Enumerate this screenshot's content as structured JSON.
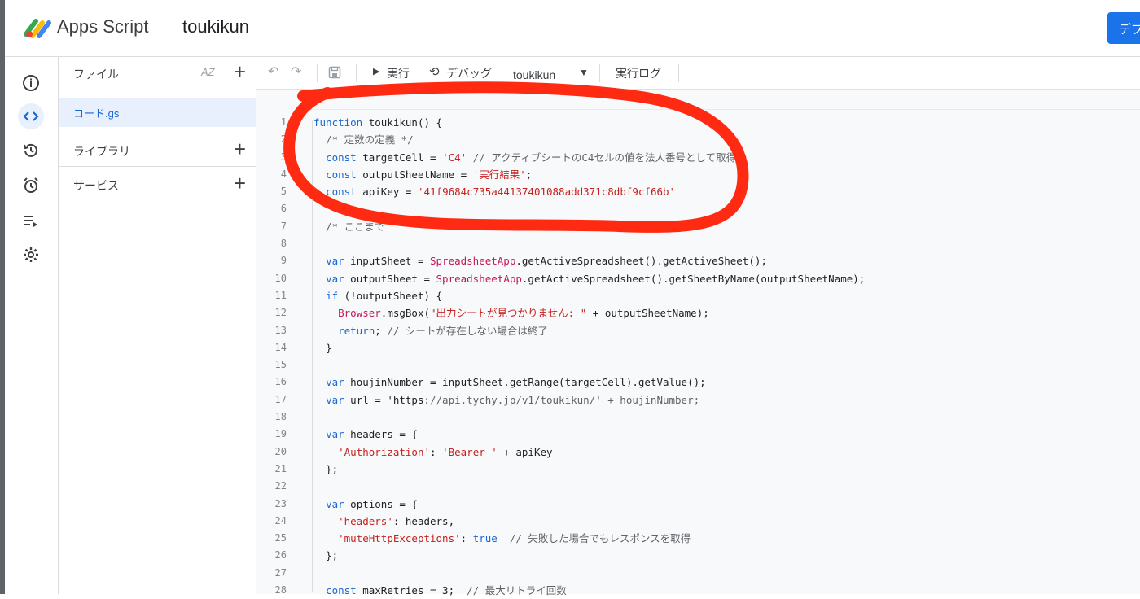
{
  "header": {
    "app_name": "Apps Script",
    "project_name": "toukikun",
    "deploy_label": "デプ"
  },
  "file_panel": {
    "files_label": "ファイル",
    "sort_label": "AZ",
    "selected_file": "コード.gs",
    "library_label": "ライブラリ",
    "services_label": "サービス"
  },
  "toolbar": {
    "run_label": "実行",
    "debug_label": "デバッグ",
    "function_select": "toukikun",
    "log_label": "実行ログ"
  },
  "code_lines": [
    {
      "n": "1",
      "html": "function toukikun() {"
    },
    {
      "n": "2",
      "html": "  /* 定数の定義 */"
    },
    {
      "n": "3",
      "html": "  const targetCell = 'C4' // アクティブシートのC4セルの値を法人番号として取得"
    },
    {
      "n": "4",
      "html": "  const outputSheetName = '実行結果';"
    },
    {
      "n": "5",
      "html": "  const apiKey = '41f9684c735a44137401088add371c8dbf9cf66b'"
    },
    {
      "n": "6",
      "html": ""
    },
    {
      "n": "7",
      "html": "  /* ここまで"
    },
    {
      "n": "8",
      "html": ""
    },
    {
      "n": "9",
      "html": "  var inputSheet = SpreadsheetApp.getActiveSpreadsheet().getActiveSheet();"
    },
    {
      "n": "10",
      "html": "  var outputSheet = SpreadsheetApp.getActiveSpreadsheet().getSheetByName(outputSheetName);"
    },
    {
      "n": "11",
      "html": "  if (!outputSheet) {"
    },
    {
      "n": "12",
      "html": "    Browser.msgBox(\"出力シートが見つかりません: \" + outputSheetName);"
    },
    {
      "n": "13",
      "html": "    return; // シートが存在しない場合は終了"
    },
    {
      "n": "14",
      "html": "  }"
    },
    {
      "n": "15",
      "html": ""
    },
    {
      "n": "16",
      "html": "  var houjinNumber = inputSheet.getRange(targetCell).getValue();"
    },
    {
      "n": "17",
      "html": "  var url = 'https://api.tychy.jp/v1/toukikun/' + houjinNumber;"
    },
    {
      "n": "18",
      "html": ""
    },
    {
      "n": "19",
      "html": "  var headers = {"
    },
    {
      "n": "20",
      "html": "    'Authorization': 'Bearer ' + apiKey"
    },
    {
      "n": "21",
      "html": "  };"
    },
    {
      "n": "22",
      "html": ""
    },
    {
      "n": "23",
      "html": "  var options = {"
    },
    {
      "n": "24",
      "html": "    'headers': headers,"
    },
    {
      "n": "25",
      "html": "    'muteHttpExceptions': true  // 失敗した場合でもレスポンスを取得"
    },
    {
      "n": "26",
      "html": "  };"
    },
    {
      "n": "27",
      "html": ""
    },
    {
      "n": "28",
      "html": "  const maxRetries = 3;  // 最大リトライ回数"
    }
  ],
  "colors": {
    "accent": "#1a73e8",
    "annotation_red": "#ff2a12"
  }
}
